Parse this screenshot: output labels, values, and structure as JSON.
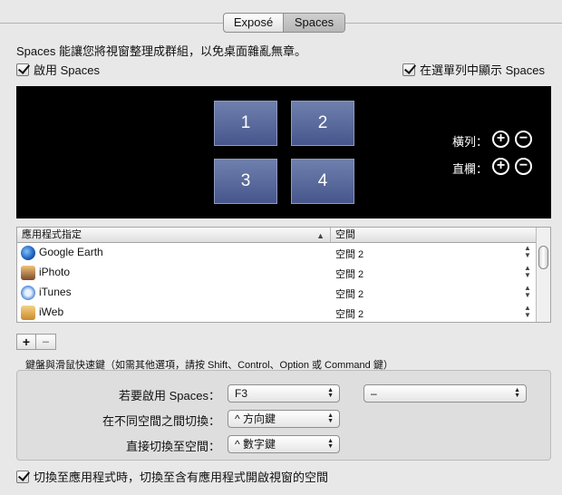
{
  "tabs": [
    {
      "label": "Exposé",
      "active": false
    },
    {
      "label": "Spaces",
      "active": true
    }
  ],
  "description": "Spaces 能讓您將視窗整理成群組，以免桌面雜亂無章。",
  "enable_spaces": {
    "label": "啟用 Spaces",
    "checked": true
  },
  "show_in_menubar": {
    "label": "在選單列中顯示 Spaces",
    "checked": true
  },
  "spaces": {
    "tiles": [
      "1",
      "2",
      "3",
      "4"
    ],
    "rows_label": "橫列：",
    "columns_label": "直欄：",
    "add_symbol": "+",
    "remove_symbol": "−"
  },
  "table": {
    "columns": [
      "應用程式指定",
      "空間"
    ],
    "sort_arrow": "▲",
    "stepper_glyph": "▲\n▼",
    "rows": [
      {
        "app": "Google Earth",
        "icon": "google-earth-icon",
        "space": "空間 2"
      },
      {
        "app": "iPhoto",
        "icon": "iphoto-icon",
        "space": "空間 2"
      },
      {
        "app": "iTunes",
        "icon": "itunes-icon",
        "space": "空間 2"
      },
      {
        "app": "iWeb",
        "icon": "iweb-icon",
        "space": "空間 2"
      }
    ]
  },
  "list_buttons": {
    "add": "+",
    "remove": "−"
  },
  "shortcuts": {
    "title": "鍵盤與滑鼠快速鍵（如需其他選項，請按 Shift、Control、Option 或 Command 鍵）",
    "activate_label": "若要啟用 Spaces：",
    "activate_key": "F3",
    "activate_mouse": "–",
    "switch_label": "在不同空間之間切換：",
    "switch_value": "^ 方向鍵",
    "direct_label": "直接切換至空間：",
    "direct_value": "^ 數字鍵"
  },
  "switch_option": {
    "label": "切換至應用程式時，切換至含有應用程式開啟視窗的空間",
    "checked": true
  }
}
